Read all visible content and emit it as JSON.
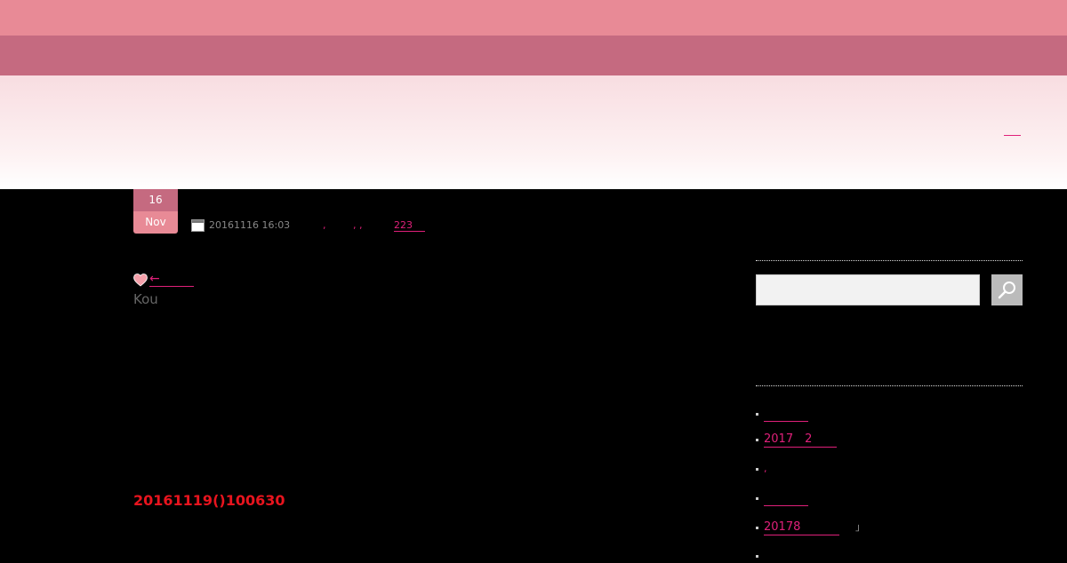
{
  "post": {
    "day": "16",
    "month": "Nov",
    "datetime": "20161116 16:03",
    "count_link": "223",
    "back_arrow": "←",
    "author": "Kou",
    "highlight": "20161119()100630"
  },
  "sidebar": {
    "search": {
      "placeholder": ""
    },
    "items": [
      {
        "label": ""
      },
      {
        "label": "2017　2"
      },
      {
        "label": ""
      },
      {
        "label": ""
      },
      {
        "label": "20178"
      }
    ]
  },
  "colors": {
    "accent": "#e0207a",
    "pink_light": "#e88a96",
    "pink_dark": "#c56a80",
    "highlight_red": "#e8141e"
  }
}
